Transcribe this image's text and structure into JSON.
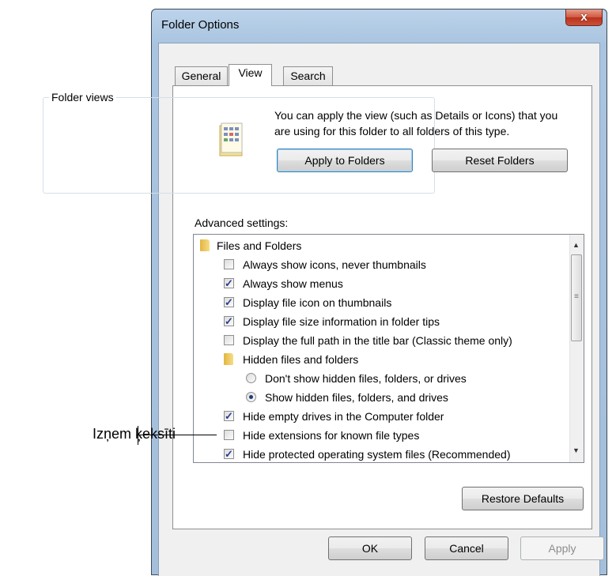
{
  "window": {
    "title": "Folder Options",
    "close_glyph": "x"
  },
  "tabs": [
    {
      "label": "General"
    },
    {
      "label": "View"
    },
    {
      "label": "Search"
    }
  ],
  "folder_views": {
    "group_label": "Folder views",
    "description": "You can apply the view (such as Details or Icons) that you are using for this folder to all folders of this type.",
    "apply_label": "Apply to Folders",
    "reset_label": "Reset Folders"
  },
  "advanced": {
    "label": "Advanced settings:",
    "items": [
      {
        "type": "folder",
        "label": "Files and Folders"
      },
      {
        "type": "checkbox",
        "checked": false,
        "label": "Always show icons, never thumbnails"
      },
      {
        "type": "checkbox",
        "checked": true,
        "label": "Always show menus"
      },
      {
        "type": "checkbox",
        "checked": true,
        "label": "Display file icon on thumbnails"
      },
      {
        "type": "checkbox",
        "checked": true,
        "label": "Display file size information in folder tips"
      },
      {
        "type": "checkbox",
        "checked": false,
        "label": "Display the full path in the title bar (Classic theme only)"
      },
      {
        "type": "folder",
        "label": "Hidden files and folders"
      },
      {
        "type": "radio",
        "checked": false,
        "label": "Don't show hidden files, folders, or drives"
      },
      {
        "type": "radio",
        "checked": true,
        "label": "Show hidden files, folders, and drives"
      },
      {
        "type": "checkbox",
        "checked": true,
        "label": "Hide empty drives in the Computer folder"
      },
      {
        "type": "checkbox",
        "checked": false,
        "label": "Hide extensions for known file types"
      },
      {
        "type": "checkbox",
        "checked": true,
        "label": "Hide protected operating system files (Recommended)"
      }
    ]
  },
  "buttons": {
    "restore": "Restore Defaults",
    "ok": "OK",
    "cancel": "Cancel",
    "apply": "Apply"
  },
  "callout": {
    "text": "Izņem ķeksīti"
  },
  "colors": {
    "accent": "#3c7fb1",
    "check": "#2a3c8d",
    "close": "#c9513a"
  }
}
